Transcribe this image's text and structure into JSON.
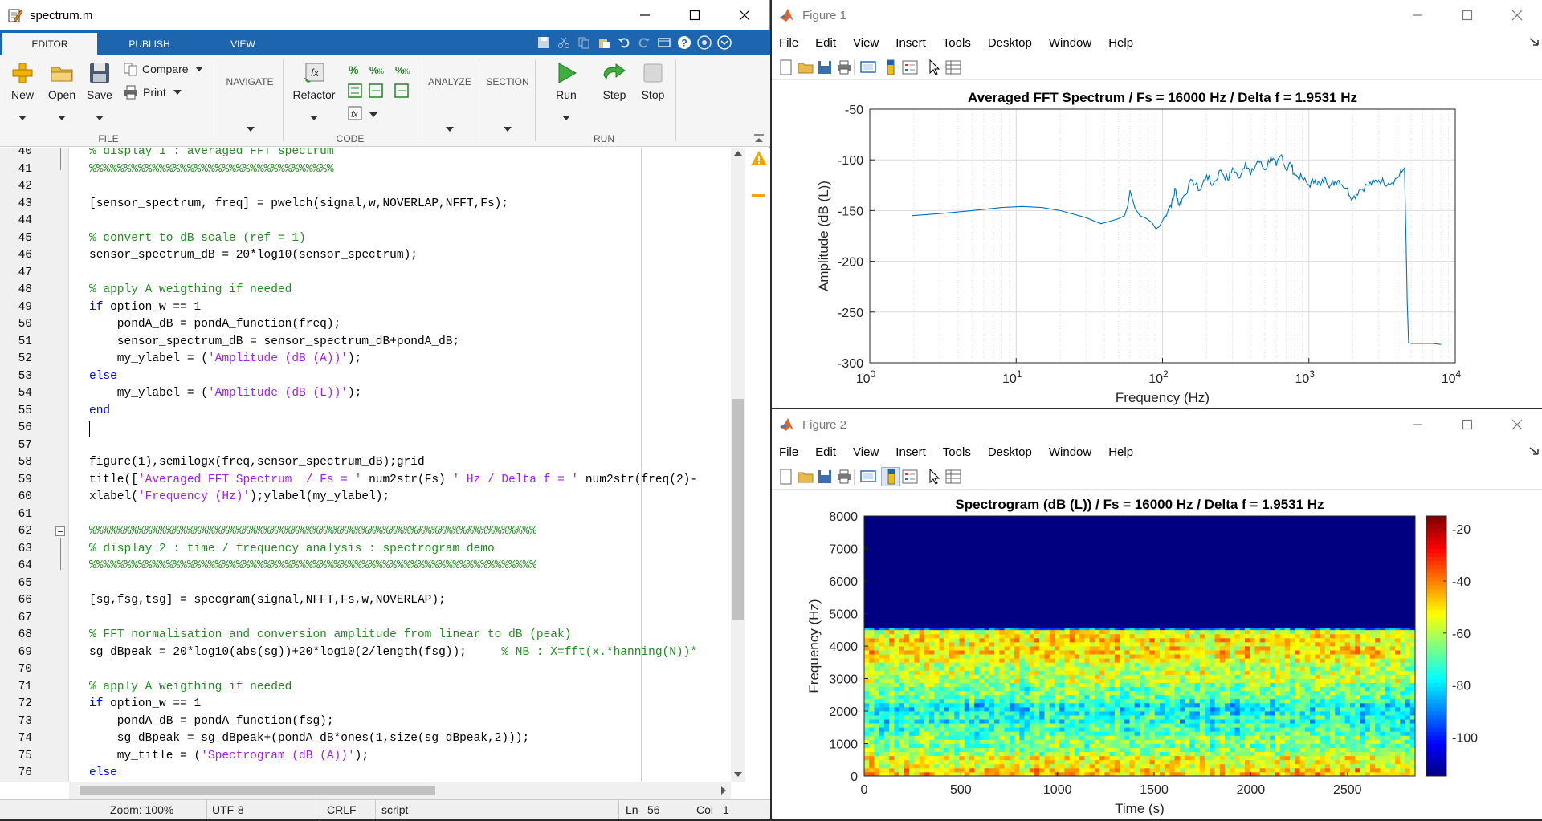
{
  "editor": {
    "title": "spectrum.m",
    "tabs": [
      "EDITOR",
      "PUBLISH",
      "VIEW"
    ],
    "ribbon": {
      "new": "New",
      "open": "Open",
      "save": "Save",
      "compare": "Compare",
      "print": "Print",
      "navigate": "NAVIGATE",
      "refactor": "Refactor",
      "analyze": "ANALYZE",
      "section": "SECTION",
      "run": "Run",
      "step": "Step",
      "stop": "Stop",
      "group_file": "FILE",
      "group_code": "CODE",
      "group_run": "RUN"
    },
    "code_lines": [
      {
        "n": "40",
        "t": [
          {
            "c": "cm",
            "s": "% display 1 : averaged FFT spectrum"
          }
        ]
      },
      {
        "n": "41",
        "t": [
          {
            "c": "cm",
            "s": "%%%%%%%%%%%%%%%%%%%%%%%%%%%%%%%%%%%"
          }
        ]
      },
      {
        "n": "42",
        "t": []
      },
      {
        "n": "43",
        "t": [
          {
            "c": "",
            "s": "[sensor_spectrum, freq] = pwelch(signal,w,NOVERLAP,NFFT,Fs);"
          }
        ]
      },
      {
        "n": "44",
        "t": []
      },
      {
        "n": "45",
        "t": [
          {
            "c": "cm",
            "s": "% convert to dB scale (ref = 1)"
          }
        ]
      },
      {
        "n": "46",
        "t": [
          {
            "c": "",
            "s": "sensor_spectrum_dB = 20*log10(sensor_spectrum);"
          }
        ]
      },
      {
        "n": "47",
        "t": []
      },
      {
        "n": "48",
        "t": [
          {
            "c": "cm",
            "s": "% apply A weigthing if needed"
          }
        ]
      },
      {
        "n": "49",
        "t": [
          {
            "c": "kw",
            "s": "if"
          },
          {
            "c": "",
            "s": " option_w == 1"
          }
        ]
      },
      {
        "n": "50",
        "t": [
          {
            "c": "",
            "s": "    pondA_dB = pondA_function(freq);"
          }
        ]
      },
      {
        "n": "51",
        "t": [
          {
            "c": "",
            "s": "    sensor_spectrum_dB = sensor_spectrum_dB+pondA_dB;"
          }
        ]
      },
      {
        "n": "52",
        "t": [
          {
            "c": "",
            "s": "    my_ylabel = ("
          },
          {
            "c": "str",
            "s": "'Amplitude (dB (A))'"
          },
          {
            "c": "",
            "s": ");"
          }
        ]
      },
      {
        "n": "53",
        "t": [
          {
            "c": "kw",
            "s": "else"
          }
        ]
      },
      {
        "n": "54",
        "t": [
          {
            "c": "",
            "s": "    my_ylabel = ("
          },
          {
            "c": "str",
            "s": "'Amplitude (dB (L))'"
          },
          {
            "c": "",
            "s": ");"
          }
        ]
      },
      {
        "n": "55",
        "t": [
          {
            "c": "kw",
            "s": "end"
          }
        ]
      },
      {
        "n": "56",
        "t": []
      },
      {
        "n": "57",
        "t": []
      },
      {
        "n": "58",
        "t": [
          {
            "c": "",
            "s": "figure(1),semilogx(freq,sensor_spectrum_dB);grid"
          }
        ]
      },
      {
        "n": "59",
        "t": [
          {
            "c": "",
            "s": "title(["
          },
          {
            "c": "str",
            "s": "'Averaged FFT Spectrum  / Fs = '"
          },
          {
            "c": "",
            "s": " num2str(Fs) "
          },
          {
            "c": "str",
            "s": "' Hz / Delta f = '"
          },
          {
            "c": "",
            "s": " num2str(freq(2)-"
          }
        ]
      },
      {
        "n": "60",
        "t": [
          {
            "c": "",
            "s": "xlabel("
          },
          {
            "c": "str",
            "s": "'Frequency (Hz)'"
          },
          {
            "c": "",
            "s": ");ylabel(my_ylabel);"
          }
        ]
      },
      {
        "n": "61",
        "t": []
      },
      {
        "n": "62",
        "t": [
          {
            "c": "cm",
            "s": "%%%%%%%%%%%%%%%%%%%%%%%%%%%%%%%%%%%%%%%%%%%%%%%%%%%%%%%%%%%%%%%%"
          }
        ]
      },
      {
        "n": "63",
        "t": [
          {
            "c": "cm",
            "s": "% display 2 : time / frequency analysis : spectrogram demo"
          }
        ]
      },
      {
        "n": "64",
        "t": [
          {
            "c": "cm",
            "s": "%%%%%%%%%%%%%%%%%%%%%%%%%%%%%%%%%%%%%%%%%%%%%%%%%%%%%%%%%%%%%%%%"
          }
        ]
      },
      {
        "n": "65",
        "t": []
      },
      {
        "n": "66",
        "t": [
          {
            "c": "",
            "s": "[sg,fsg,tsg] = specgram(signal,NFFT,Fs,w,NOVERLAP);"
          }
        ]
      },
      {
        "n": "67",
        "t": []
      },
      {
        "n": "68",
        "t": [
          {
            "c": "cm",
            "s": "% FFT normalisation and conversion amplitude from linear to dB (peak)"
          }
        ]
      },
      {
        "n": "69",
        "t": [
          {
            "c": "",
            "s": "sg_dBpeak = 20*log10(abs(sg))+20*log10(2/length(fsg));     "
          },
          {
            "c": "cm",
            "s": "% NB : X=fft(x.*hanning(N))*"
          }
        ]
      },
      {
        "n": "70",
        "t": []
      },
      {
        "n": "71",
        "t": [
          {
            "c": "cm",
            "s": "% apply A weigthing if needed"
          }
        ]
      },
      {
        "n": "72",
        "t": [
          {
            "c": "kw",
            "s": "if"
          },
          {
            "c": "",
            "s": " option_w == 1"
          }
        ]
      },
      {
        "n": "73",
        "t": [
          {
            "c": "",
            "s": "    pondA_dB = pondA_function(fsg);"
          }
        ]
      },
      {
        "n": "74",
        "t": [
          {
            "c": "",
            "s": "    sg_dBpeak = sg_dBpeak+(pondA_dB*ones(1,size(sg_dBpeak,2)));"
          }
        ]
      },
      {
        "n": "75",
        "t": [
          {
            "c": "",
            "s": "    my_title = ("
          },
          {
            "c": "str",
            "s": "'Spectrogram (dB (A))'"
          },
          {
            "c": "",
            "s": ");"
          }
        ]
      },
      {
        "n": "76",
        "t": [
          {
            "c": "kw",
            "s": "else"
          }
        ]
      }
    ],
    "status": {
      "zoom": "Zoom: 100%",
      "encoding": "UTF-8",
      "line_end": "CRLF",
      "type": "script",
      "ln_label": "Ln",
      "ln": "56",
      "col_label": "Col",
      "col": "1"
    }
  },
  "figure1": {
    "title": "Figure 1",
    "menu": [
      "File",
      "Edit",
      "View",
      "Insert",
      "Tools",
      "Desktop",
      "Window",
      "Help"
    ],
    "chart_data": {
      "type": "line",
      "title": "Averaged FFT Spectrum  / Fs = 16000 Hz / Delta f = 1.9531 Hz",
      "xlabel": "Frequency (Hz)",
      "ylabel": "Amplitude (dB (L))",
      "xscale": "log",
      "xlim": [
        1,
        10000
      ],
      "ylim": [
        -300,
        -50
      ],
      "grid": true,
      "x_tick_labels": [
        "10^0",
        "10^1",
        "10^2",
        "10^3",
        "10^4"
      ],
      "y_ticks": [
        -50,
        -100,
        -150,
        -200,
        -250,
        -300
      ],
      "color": "#0072bd",
      "series": [
        {
          "x": [
            1.95,
            3,
            5,
            8,
            11,
            15,
            20,
            30,
            38,
            45,
            50,
            55,
            58,
            60,
            62,
            65,
            70,
            78,
            85,
            90,
            95,
            100,
            110,
            118,
            122,
            130,
            140,
            160,
            180,
            200,
            220,
            250,
            280,
            300,
            330,
            370,
            400,
            450,
            500,
            550,
            600,
            650,
            700,
            750,
            800,
            900,
            1000,
            1100,
            1200,
            1300,
            1400,
            1500,
            1600,
            1800,
            2000,
            2200,
            2500,
            2800,
            3000,
            3500,
            4000,
            4300,
            4500,
            4600,
            4700,
            4800,
            5000,
            6000,
            7000,
            8000
          ],
          "y": [
            -155,
            -153,
            -150,
            -147,
            -146,
            -147,
            -150,
            -157,
            -163,
            -160,
            -158,
            -155,
            -145,
            -130,
            -138,
            -148,
            -155,
            -158,
            -162,
            -168,
            -166,
            -160,
            -148,
            -140,
            -128,
            -145,
            -135,
            -120,
            -130,
            -115,
            -125,
            -110,
            -120,
            -108,
            -118,
            -102,
            -115,
            -100,
            -110,
            -97,
            -106,
            -95,
            -110,
            -103,
            -115,
            -118,
            -125,
            -120,
            -125,
            -118,
            -125,
            -122,
            -120,
            -128,
            -138,
            -130,
            -125,
            -122,
            -120,
            -123,
            -118,
            -112,
            -108,
            -170,
            -240,
            -280,
            -281,
            -281,
            -281,
            -282
          ]
        }
      ]
    }
  },
  "figure2": {
    "title": "Figure 2",
    "menu": [
      "File",
      "Edit",
      "View",
      "Insert",
      "Tools",
      "Desktop",
      "Window",
      "Help"
    ],
    "chart_data": {
      "type": "heatmap",
      "title": "Spectrogram (dB (L)) / Fs = 16000 Hz / Delta f = 1.9531 Hz",
      "xlabel": "Time (s)",
      "ylabel": "Frequency (Hz)",
      "xlim": [
        0,
        2850
      ],
      "ylim": [
        0,
        8000
      ],
      "x_ticks": [
        0,
        500,
        1000,
        1500,
        2000,
        2500
      ],
      "y_ticks": [
        0,
        1000,
        2000,
        3000,
        4000,
        5000,
        6000,
        7000,
        8000
      ],
      "colorbar_ticks": [
        -20,
        -40,
        -60,
        -80,
        -100
      ],
      "clim": [
        -115,
        -15
      ],
      "colormap": "jet",
      "cutoff_frequency_hz": 4550,
      "band_levels_db": [
        {
          "f": 0,
          "db": -50
        },
        {
          "f": 500,
          "db": -55
        },
        {
          "f": 800,
          "db": -62
        },
        {
          "f": 1500,
          "db": -70
        },
        {
          "f": 2000,
          "db": -78
        },
        {
          "f": 2500,
          "db": -70
        },
        {
          "f": 3000,
          "db": -62
        },
        {
          "f": 3500,
          "db": -55
        },
        {
          "f": 4000,
          "db": -50
        },
        {
          "f": 4500,
          "db": -55
        },
        {
          "f": 4600,
          "db": -115
        },
        {
          "f": 8000,
          "db": -115
        }
      ]
    }
  }
}
